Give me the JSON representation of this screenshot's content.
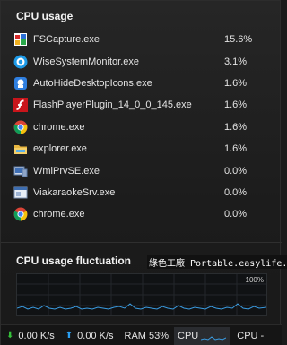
{
  "cpu_usage": {
    "title": "CPU usage",
    "processes": [
      {
        "name": "FSCapture.exe",
        "value": "15.6%",
        "icon": "fscapture-icon"
      },
      {
        "name": "WiseSystemMonitor.exe",
        "value": "3.1%",
        "icon": "wise-monitor-icon"
      },
      {
        "name": "AutoHideDesktopIcons.exe",
        "value": "1.6%",
        "icon": "autohide-icon"
      },
      {
        "name": "FlashPlayerPlugin_14_0_0_145.exe",
        "value": "1.6%",
        "icon": "flash-icon"
      },
      {
        "name": "chrome.exe",
        "value": "1.6%",
        "icon": "chrome-icon"
      },
      {
        "name": "explorer.exe",
        "value": "1.6%",
        "icon": "explorer-icon"
      },
      {
        "name": "WmiPrvSE.exe",
        "value": "0.0%",
        "icon": "wmi-icon"
      },
      {
        "name": "ViakaraokeSrv.exe",
        "value": "0.0%",
        "icon": "service-window-icon"
      },
      {
        "name": "chrome.exe",
        "value": "0.0%",
        "icon": "chrome-icon"
      }
    ]
  },
  "fluctuation": {
    "title": "CPU usage fluctuation",
    "max_label": "100%",
    "line_color": "#3a9be0"
  },
  "watermark": "綠色工廠 Portable.easylife.tw",
  "statusbar": {
    "download": "0.00 K/s",
    "upload": "0.00 K/s",
    "ram": "RAM 53%",
    "cpu_label": "CPU",
    "cpu2_label": "CPU -"
  },
  "colors": {
    "download_arrow": "#35c23a",
    "upload_arrow": "#2a9ef0",
    "graph_line": "#3a9be0"
  }
}
